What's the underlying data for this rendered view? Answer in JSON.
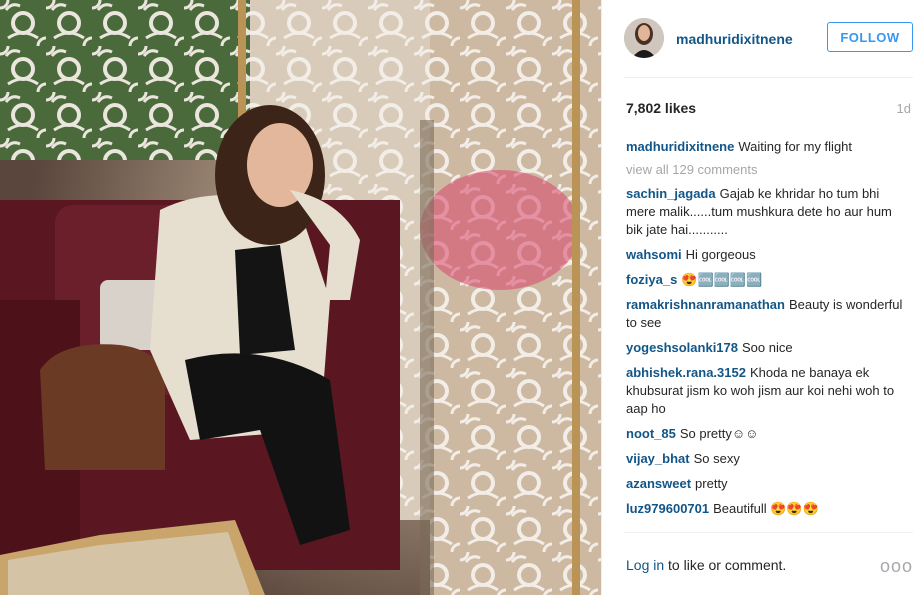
{
  "post": {
    "username": "madhuridixitnene",
    "follow_label": "FOLLOW",
    "likes": "7,802 likes",
    "age": "1d",
    "caption_user": "madhuridixitnene",
    "caption_text": "Waiting for my flight",
    "view_all": "view all 129 comments",
    "photo_alt": "photo"
  },
  "comments": [
    {
      "user": "sachin_jagada",
      "text": "Gajab ke khridar ho tum bhi mere malik......tum mushkura dete ho aur hum bik jate hai..........."
    },
    {
      "user": "wahsomi",
      "text": "Hi gorgeous"
    },
    {
      "user": "foziya_s",
      "text": "😍🆒🆒🆒🆒"
    },
    {
      "user": "ramakrishnanramanathan",
      "text": "Beauty is wonderful to see"
    },
    {
      "user": "yogeshsolanki178",
      "text": "Soo nice"
    },
    {
      "user": "abhishek.rana.3152",
      "text": "Khoda ne banaya ek khubsurat jism ko woh jism aur koi nehi woh to aap ho"
    },
    {
      "user": "noot_85",
      "text": "So pretty☺☺"
    },
    {
      "user": "vijay_bhat",
      "text": "So sexy"
    },
    {
      "user": "azansweet",
      "text": "pretty"
    },
    {
      "user": "luz979600701",
      "text": "Beautifull 😍😍😍"
    }
  ],
  "footer": {
    "login_link": "Log in",
    "login_rest": " to like or comment.",
    "more": "ooo"
  },
  "colors": {
    "username": "#125688",
    "follow": "#3897f0",
    "muted": "#a5a7aa"
  }
}
